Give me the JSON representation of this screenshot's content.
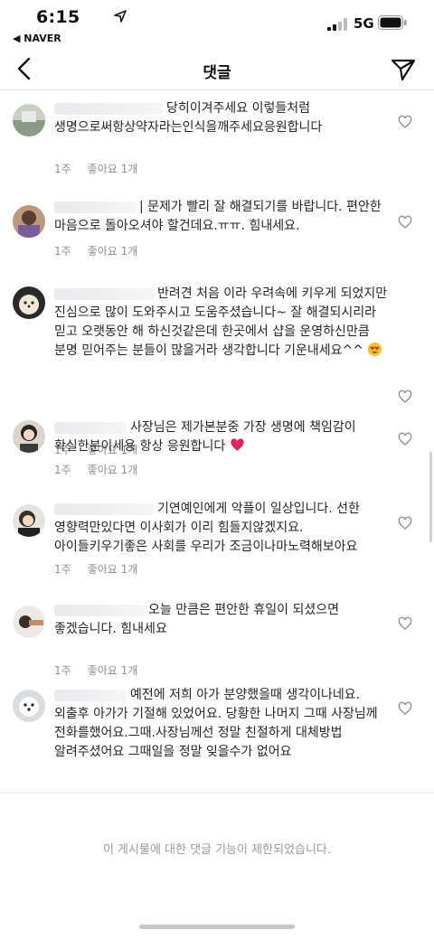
{
  "status_bar": {
    "time": "6:15",
    "back_app": "◀ NAVER",
    "network": "5G"
  },
  "header": {
    "title": "댓글"
  },
  "comments": [
    {
      "text": "당히이겨주세요 이렇들처럼 생명으로써항상약자라는인식을깨주세요응원합니다",
      "time": "1주",
      "likes": "좋아요 1개"
    },
    {
      "text": "| 문제가 빨리 잘 해결되기를 바랍니다. 편안한 마음으로 돌아오셔야 할건데요.ㅠㅠ. 힘내세요.",
      "time": "1주",
      "likes": "좋아요 1개"
    },
    {
      "text": "반려견 처음 이라 우려속에 키우게 되었지만 진심으로 많이 도와주시고 도움주셨습니다~ 잘 해결되시리라 믿고 오랫동안 해 하신것같은데 한곳에서 샵을 운영하신만큼 분명 믿어주는 분들이 많을거라 생각합니다 기운내세요^^",
      "time": "1주",
      "likes": "좋아요 1개"
    },
    {
      "text": "사장님은 제가본분중 가장 생명에 책임감이 확실한분이세용 항상 응원합니다",
      "time": "1주",
      "likes": "좋아요 1개"
    },
    {
      "text": "기연예인에게 악플이 일상입니다. 선한 영향력만있다면 이사회가 이리 힘들지않겠지요.아이들키우기좋은 사회를 우리가 조금이나마노력해보아요",
      "time": "1주",
      "likes": "좋아요 1개"
    },
    {
      "text": "오늘 만큼은 편안한 휴일이 되셨으면 좋겠습니다. 힘내세요",
      "time": "1주",
      "likes": "좋아요 1개"
    },
    {
      "text": "예전에 저희 아가 분양했을때 생각이나네요. 외출후 아가가 기절해 있었어요. 당황한 나머지 그때 사장님께 전화를했어요.그때.사장님께선 정말 친절하게 대체방법 알려주셨어요 그때일을 정말 잊을수가 없어요",
      "time": "",
      "likes": ""
    }
  ],
  "restricted_notice": "이 게시물에 대한 댓글 기능이 제한되었습니다.",
  "icons": {
    "back": "chevron-left-icon",
    "send": "paper-plane-icon",
    "like": "heart-outline-icon",
    "location": "location-arrow-icon",
    "signal": "signal-bars-icon",
    "battery": "battery-icon",
    "emoji_smile": "heart-eyes-emoji",
    "emoji_heart": "red-heart-emoji"
  },
  "colors": {
    "text": "#262626",
    "meta": "#8e8e8e",
    "heart_emoji": "#e0245e"
  }
}
